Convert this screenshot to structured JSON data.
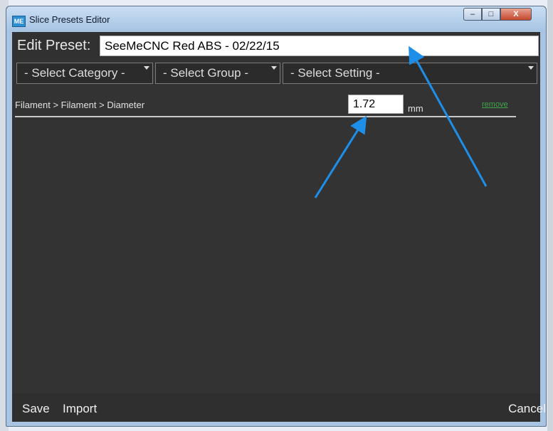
{
  "window": {
    "title": "Slice Presets Editor",
    "icon_text": "ME",
    "controls": {
      "minimize": "–",
      "maximize": "□",
      "close": "X"
    }
  },
  "editor": {
    "label": "Edit Preset:",
    "preset_name": "SeeMeCNC Red ABS - 02/22/15"
  },
  "selectors": {
    "category": "- Select Category -",
    "group": "- Select Group -",
    "setting": "- Select Setting -"
  },
  "settings": [
    {
      "path": "Filament > Filament > Diameter",
      "value": "1.72",
      "unit": "mm",
      "remove_label": "remove"
    }
  ],
  "footer": {
    "save": "Save",
    "import": "Import",
    "cancel": "Cancel"
  },
  "colors": {
    "arrow": "#1e8fe8",
    "remove_link": "#3ea84a",
    "panel": "#333333"
  }
}
